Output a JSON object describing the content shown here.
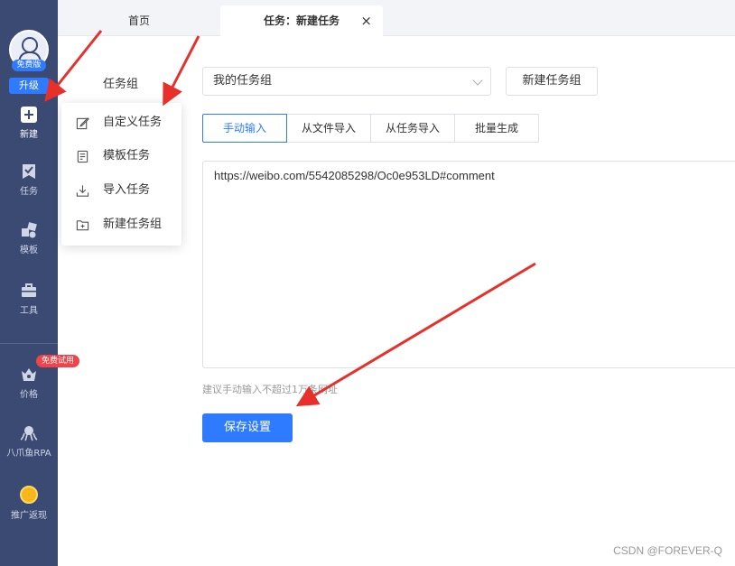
{
  "sidebar": {
    "free_badge": "免费版",
    "upgrade": "升级",
    "items": [
      {
        "label": "新建",
        "icon": "plus-icon"
      },
      {
        "label": "任务",
        "icon": "task-icon"
      },
      {
        "label": "模板",
        "icon": "template-icon"
      },
      {
        "label": "工具",
        "icon": "toolbox-icon"
      },
      {
        "label": "价格",
        "icon": "price-icon"
      },
      {
        "label": "八爪鱼RPA",
        "icon": "octopus-icon"
      },
      {
        "label": "推广返现",
        "icon": "coin-icon"
      }
    ],
    "trial_badge": "免费试用"
  },
  "tabs": {
    "home": "首页",
    "current": "任务：新建任务",
    "close": "×"
  },
  "form": {
    "group_label": "任务组",
    "group_value": "我的任务组",
    "new_group_button": "新建任务组",
    "input_tabs": [
      "手动输入",
      "从文件导入",
      "从任务导入",
      "批量生成"
    ],
    "active_tab": 0,
    "url_text": "https://weibo.com/5542085298/Oc0e953LD#comment",
    "hint": "建议手动输入不超过1万条网址",
    "save_button": "保存设置"
  },
  "menu": {
    "items": [
      {
        "label": "自定义任务",
        "icon": "edit-icon"
      },
      {
        "label": "模板任务",
        "icon": "document-icon"
      },
      {
        "label": "导入任务",
        "icon": "import-icon"
      },
      {
        "label": "新建任务组",
        "icon": "folder-plus-icon"
      }
    ]
  },
  "watermark": "CSDN @FOREVER-Q",
  "colors": {
    "sidebar": "#3b4a73",
    "primary": "#2f7bff",
    "badge_red": "#f0444b",
    "arrow_red": "#e8302b"
  }
}
